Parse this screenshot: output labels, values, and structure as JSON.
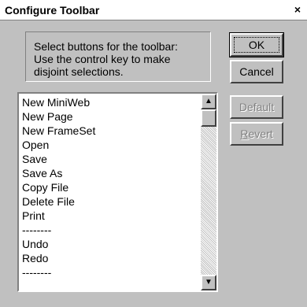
{
  "window": {
    "title": "Configure Toolbar",
    "close_glyph": "×"
  },
  "instructions": {
    "line1": "Select buttons for the toolbar:",
    "line2": "Use the control key to make",
    "line3": "disjoint selections."
  },
  "buttons": {
    "ok": "OK",
    "cancel": "Cancel",
    "default": "Default",
    "revert_first": "R",
    "revert_rest": "evert"
  },
  "list": {
    "items": [
      "New MiniWeb",
      "New Page",
      "New FrameSet",
      "Open",
      "Save",
      "Save As",
      "Copy File",
      "Delete File",
      "Print",
      "--------",
      "Undo",
      "Redo",
      "--------"
    ]
  },
  "scrollbar": {
    "up_glyph": "▲",
    "down_glyph": "▼"
  }
}
